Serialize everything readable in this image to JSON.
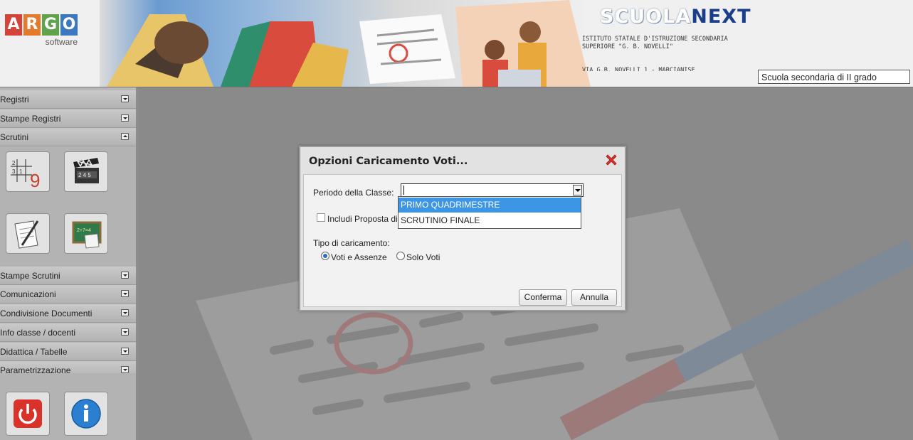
{
  "header": {
    "logo_letters": [
      "A",
      "R",
      "G",
      "O"
    ],
    "logo_subtitle": "software",
    "brand_part1": "SCUOLA",
    "brand_part2": "NEXT",
    "school_name": "ISTITUTO STATALE D'ISTRUZIONE SECONDARIA SUPERIORE \"G. B. NOVELLI\"",
    "school_address": "VIA G.B. NOVELLI 1 - MARCIANISE",
    "school_type": "Scuola secondaria di II grado"
  },
  "sidebar": {
    "menu_top": [
      {
        "label": "Registri",
        "state": "collapsed"
      },
      {
        "label": "Stampe Registri",
        "state": "collapsed"
      },
      {
        "label": "Scrutini",
        "state": "expanded"
      }
    ],
    "menu_bottom": [
      {
        "label": "Stampe Scrutini",
        "state": "collapsed"
      },
      {
        "label": "Comunicazioni",
        "state": "collapsed"
      },
      {
        "label": "Condivisione Documenti",
        "state": "collapsed"
      },
      {
        "label": "Info classe / docenti",
        "state": "collapsed"
      },
      {
        "label": "Didattica / Tabelle",
        "state": "collapsed"
      },
      {
        "label": "Parametrizzazione",
        "state": "collapsed"
      }
    ],
    "scrutini_tiles": [
      "grid-9-icon",
      "clapperboard-icon",
      "pencil-paper-icon",
      "blackboard-icon"
    ],
    "bottom_tiles": [
      "power-icon",
      "info-icon"
    ]
  },
  "dialog": {
    "title": "Opzioni Caricamento Voti...",
    "periodo_label": "Periodo della Classe:",
    "periodo_value": "",
    "includi_label": "Includi Proposta di voto",
    "includi_checked": false,
    "tipo_label": "Tipo di caricamento:",
    "radio_options": [
      {
        "label": "Voti e Assenze",
        "selected": true
      },
      {
        "label": "Solo Voti",
        "selected": false
      }
    ],
    "confirm_label": "Conferma",
    "cancel_label": "Annulla"
  },
  "dropdown": {
    "options": [
      "PRIMO QUADRIMESTRE",
      "SCRUTINIO FINALE"
    ],
    "highlighted": "PRIMO QUADRIMESTRE"
  },
  "colors": {
    "accent_blue": "#3d95e6",
    "brand_dark": "#1a3e8a",
    "close_red": "#d8322a"
  }
}
